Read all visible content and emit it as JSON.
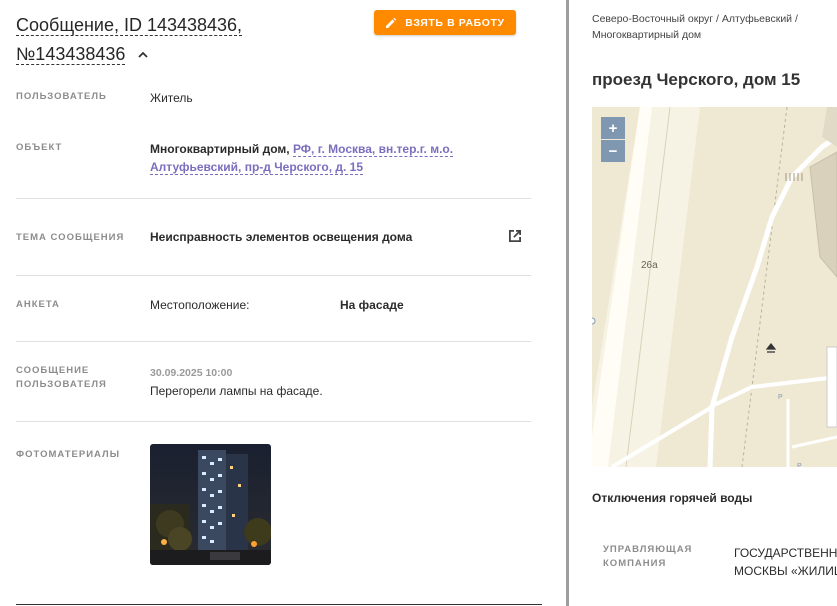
{
  "header": {
    "title_line1": "Сообщение, ID 143438436,",
    "title_line2": "№143438436",
    "take_button": "ВЗЯТЬ В РАБОТУ"
  },
  "fields": {
    "user_label": "ПОЛЬЗОВАТЕЛЬ",
    "user_value": "Житель",
    "object_label": "ОБЪЕКТ",
    "object_type": "Многоквартирный дом,",
    "object_addr1": "РФ, г. Москва, вн.тер.г. м.о.",
    "object_addr2": "Алтуфьевский, пр-д Черского, д. 15",
    "topic_label": "ТЕМА СООБЩЕНИЯ",
    "topic_value": "Неисправность элементов освещения дома",
    "survey_label": "АНКЕТА",
    "survey_key": "Местоположение:",
    "survey_value": "На фасаде",
    "msg_label_1": "СООБЩЕНИЕ",
    "msg_label_2": "ПОЛЬЗОВАТЕЛЯ",
    "msg_date": "30.09.2025 10:00",
    "msg_text": "Перегорели лампы на фасаде.",
    "photo_label": "ФОТОМАТЕРИАЛЫ"
  },
  "right": {
    "breadcrumb_1": "Северо-Восточный округ / Алтуфьевский /",
    "breadcrumb_2": "Многоквартирный дом",
    "address_title": "проезд Черского, дом 15",
    "map_zoom_in": "+",
    "map_zoom_out": "−",
    "map_label_26a": "26а",
    "map_label_p1": "P",
    "map_label_p2": "P",
    "hot_water_title": "Отключения горячей воды",
    "mc_label_1": "УПРАВЛЯЮЩАЯ",
    "mc_label_2": "КОМПАНИЯ",
    "mc_value_1": "ГОСУДАРСТВЕНН",
    "mc_value_2": "МОСКВЫ «ЖИЛИЩ"
  },
  "colors": {
    "accent": "#ff8a00",
    "link": "#7a6fbf",
    "map_bg": "#efe9d4",
    "zoom_btn": "#7f97b0"
  }
}
